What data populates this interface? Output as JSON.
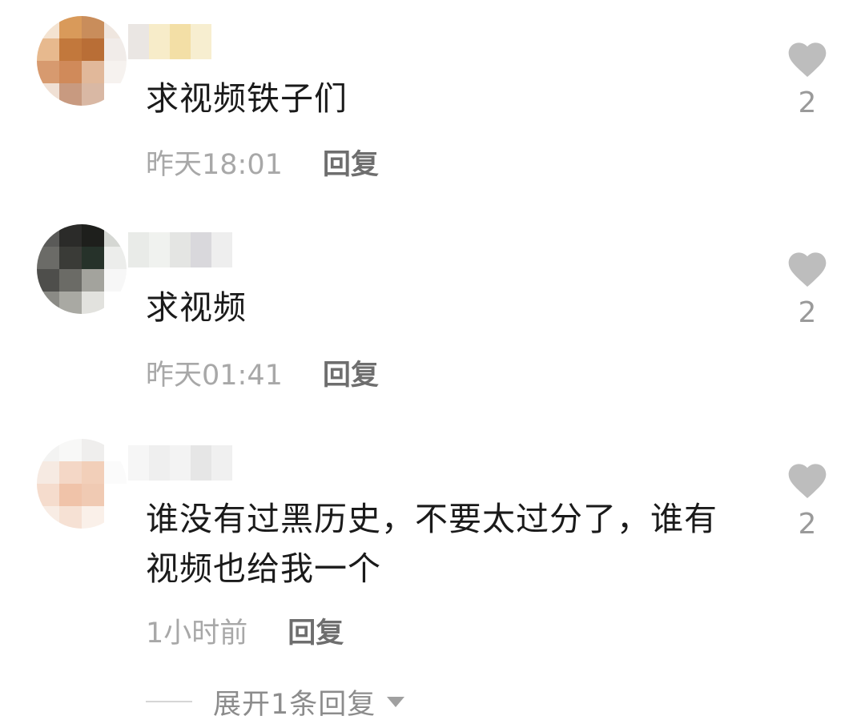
{
  "colors": {
    "like_icon": "#bdbdbd",
    "time_text": "#a8a8a8",
    "reply_text": "#6e6e6e"
  },
  "comments": [
    {
      "text": "求视频铁子们",
      "time": "昨天18:01",
      "reply_label": "回复",
      "likes": "2",
      "avatar_icon": "blurred-avatar"
    },
    {
      "text": "求视频",
      "time": "昨天01:41",
      "reply_label": "回复",
      "likes": "2",
      "avatar_icon": "blurred-avatar"
    },
    {
      "text": "谁没有过黑历史，不要太过分了，谁有视频也给我一个",
      "time": "1小时前",
      "reply_label": "回复",
      "likes": "2",
      "avatar_icon": "blurred-avatar"
    }
  ],
  "expand_replies": {
    "label": "展开1条回复",
    "icon": "chevron-down-icon"
  }
}
